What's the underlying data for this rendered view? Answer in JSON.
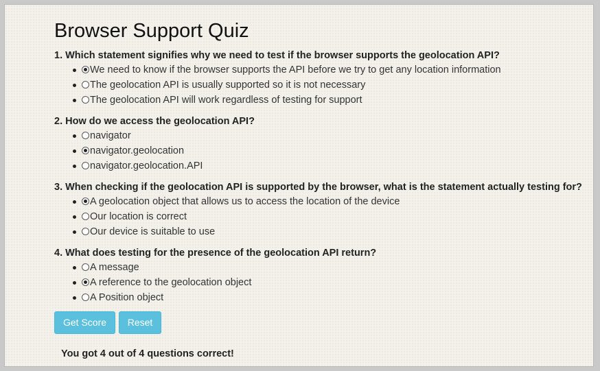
{
  "title": "Browser Support Quiz",
  "questions": [
    {
      "text": "1. Which statement signifies why we need to test if the browser supports the geolocation API?",
      "options": [
        {
          "label": "We need to know if the browser supports the API before we try to get any location information",
          "checked": true
        },
        {
          "label": "The geolocation API is usually supported so it is not necessary",
          "checked": false
        },
        {
          "label": "The geolocation API will work regardless of testing for support",
          "checked": false
        }
      ]
    },
    {
      "text": "2. How do we access the geolocation API?",
      "options": [
        {
          "label": "navigator",
          "checked": false
        },
        {
          "label": "navigator.geolocation",
          "checked": true
        },
        {
          "label": "navigator.geolocation.API",
          "checked": false
        }
      ]
    },
    {
      "text": "3. When checking if the geolocation API is supported by the browser, what is the statement actually testing for?",
      "options": [
        {
          "label": "A geolocation object that allows us to access the location of the device",
          "checked": true
        },
        {
          "label": "Our location is correct",
          "checked": false
        },
        {
          "label": "Our device is suitable to use",
          "checked": false
        }
      ]
    },
    {
      "text": "4. What does testing for the presence of the geolocation API return?",
      "options": [
        {
          "label": "A message",
          "checked": false
        },
        {
          "label": "A reference to the geolocation object",
          "checked": true
        },
        {
          "label": "A Position object",
          "checked": false
        }
      ]
    }
  ],
  "buttons": {
    "get_score": "Get Score",
    "reset": "Reset"
  },
  "result": "You got 4 out of 4 questions correct!",
  "colors": {
    "button_bg": "#5bc0de",
    "button_border": "#46b8da",
    "page_bg": "#f3f1ea"
  }
}
